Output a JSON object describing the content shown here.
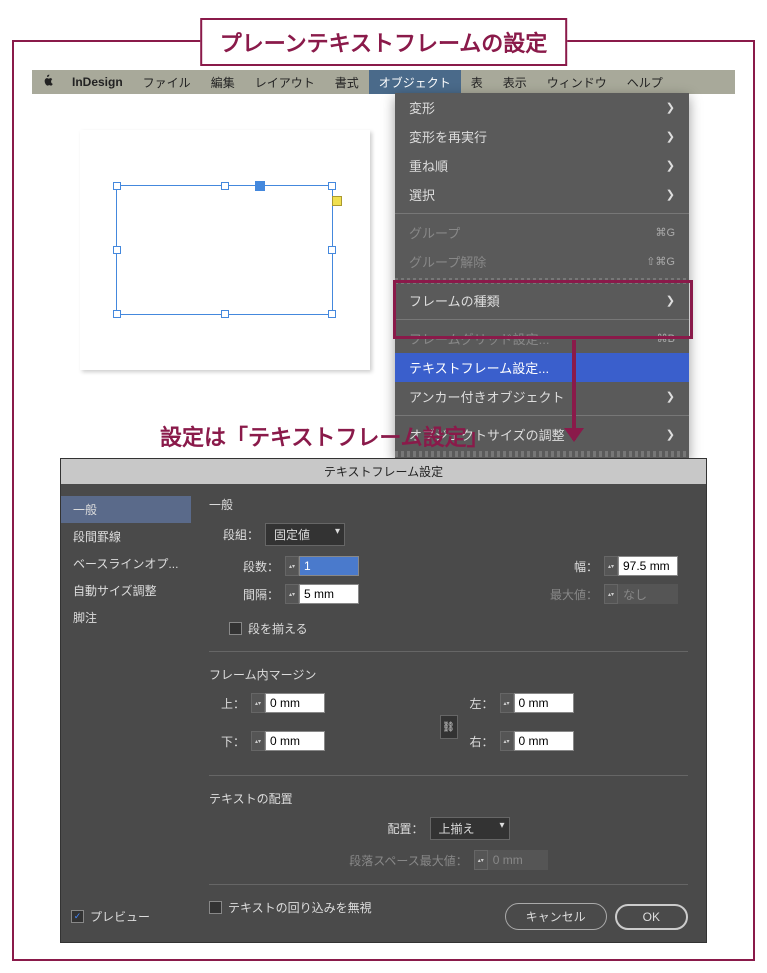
{
  "title": "プレーンテキストフレームの設定",
  "subtitle": "設定は「テキストフレーム設定」",
  "menubar": {
    "app": "InDesign",
    "items": [
      "ファイル",
      "編集",
      "レイアウト",
      "書式",
      "オブジェクト",
      "表",
      "表示",
      "ウィンドウ",
      "ヘルプ"
    ]
  },
  "dropdown": {
    "transform": "変形",
    "transform_again": "変形を再実行",
    "arrange": "重ね順",
    "select": "選択",
    "group": "グループ",
    "group_sc": "⌘G",
    "ungroup": "グループ解除",
    "ungroup_sc": "⇧⌘G",
    "frame_type": "フレームの種類",
    "frame_grid": "フレームグリッド設定...",
    "frame_grid_sc": "⌘B",
    "text_frame": "テキストフレーム設定...",
    "anchor": "アンカー付きオブジェクト",
    "fitting": "オブジェクトサイズの調整"
  },
  "dialog": {
    "title": "テキストフレーム設定",
    "sidebar": {
      "general": "一般",
      "rules": "段間罫線",
      "baseline": "ベースラインオプ...",
      "autosize": "自動サイズ調整",
      "footnote": "脚注"
    },
    "general": {
      "heading": "一般",
      "columns_label": "段組：",
      "columns_mode": "固定値",
      "count_label": "段数：",
      "count": "1",
      "gutter_label": "間隔：",
      "gutter": "5 mm",
      "width_label": "幅：",
      "width": "97.5 mm",
      "max_label": "最大値：",
      "max": "なし",
      "balance": "段を揃える"
    },
    "inset": {
      "heading": "フレーム内マージン",
      "top_label": "上：",
      "bottom_label": "下：",
      "left_label": "左：",
      "right_label": "右：",
      "value": "0 mm"
    },
    "vjust": {
      "heading": "テキストの配置",
      "align_label": "配置：",
      "align_value": "上揃え",
      "para_label": "段落スペース最大値：",
      "para_value": "0 mm"
    },
    "ignore_wrap": "テキストの回り込みを無視",
    "preview": "プレビュー",
    "cancel": "キャンセル",
    "ok": "OK"
  }
}
